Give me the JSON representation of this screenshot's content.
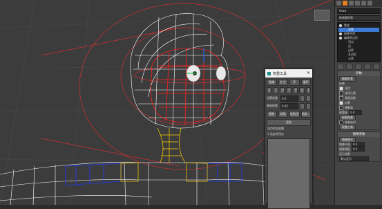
{
  "command_panel": {
    "object_name": "head",
    "modifier_list": "修改器列表",
    "stack": [
      {
        "label": "蒙皮",
        "selected": false,
        "sub": false
      },
      {
        "label": "封套",
        "selected": true,
        "sub": true
      },
      {
        "label": "网格平滑",
        "selected": false,
        "sub": false
      },
      {
        "label": "编辑多边形",
        "selected": false,
        "sub": false
      },
      {
        "label": "顶点",
        "selected": false,
        "sub": true
      },
      {
        "label": "边",
        "selected": false,
        "sub": true
      },
      {
        "label": "边界",
        "selected": false,
        "sub": true
      },
      {
        "label": "多边形",
        "selected": false,
        "sub": true
      },
      {
        "label": "元素",
        "selected": false,
        "sub": true
      }
    ],
    "rollout_params_title": "参数",
    "edit_envelopes": "编辑封套",
    "select_label": "选择",
    "vertices": "顶点",
    "select_element": "选择元素",
    "backface_cull": "背面消隐",
    "envelopes": "封套",
    "cross_sections": "横截面",
    "weight_label": "权重表",
    "weight_value": "0.0",
    "paint_weights": "绘制权重",
    "paint_blend": "绘制选项",
    "weight_tool": "权重工具",
    "rollout_mirror_title": "镜像参数",
    "mirror_mode": "镜像模式",
    "mirror_offset_label": "镜像平面",
    "mirror_threshold_label": "镜像阈值",
    "val_a": "0.0",
    "val_b": "0.0",
    "val_c": "0.5",
    "display_projection": "显示投影",
    "projection_value": "默认显示"
  },
  "dialog": {
    "title": "权重工具",
    "close": "✕",
    "row1": [
      "收缩",
      "扩大",
      "环",
      "循环"
    ],
    "row2": [
      "0",
      ".1",
      ".25",
      ".5",
      ".75",
      ".9",
      "1"
    ],
    "set_weight_label": "设置权重",
    "set_weight_value": "0.0",
    "scale_weight_label": "缩放权重",
    "scale_weight_value": "0.95",
    "row3": [
      "复制",
      "粘贴",
      "粘贴位置",
      "粘贴..."
    ],
    "blend_label": "混合",
    "total_label": "顶点的总权重",
    "vertex_info": "顶点的总权重",
    "vertex_count": "1 选定的顶点"
  },
  "viewport": {
    "colors": {
      "background": "#3c3c3c",
      "wire": "#ffffff",
      "red_weight": "#ff2020",
      "blue_weight": "#1e3cff",
      "yellow_weight": "#ffd400"
    }
  }
}
